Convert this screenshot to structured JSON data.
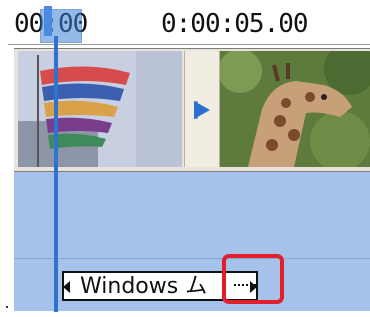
{
  "ruler": {
    "start_time": "00:00",
    "mid_time": "0:00:05.00"
  },
  "title_clip": {
    "text": "Windows ム"
  },
  "colors": {
    "track_background": "#a7c2ea",
    "playhead": "#2f73cc",
    "highlight": "#e0202a"
  },
  "icons": {
    "transition": "transition-arrow-icon",
    "trim_left": "trim-handle-left-icon",
    "trim_right": "trim-handle-right-icon"
  }
}
